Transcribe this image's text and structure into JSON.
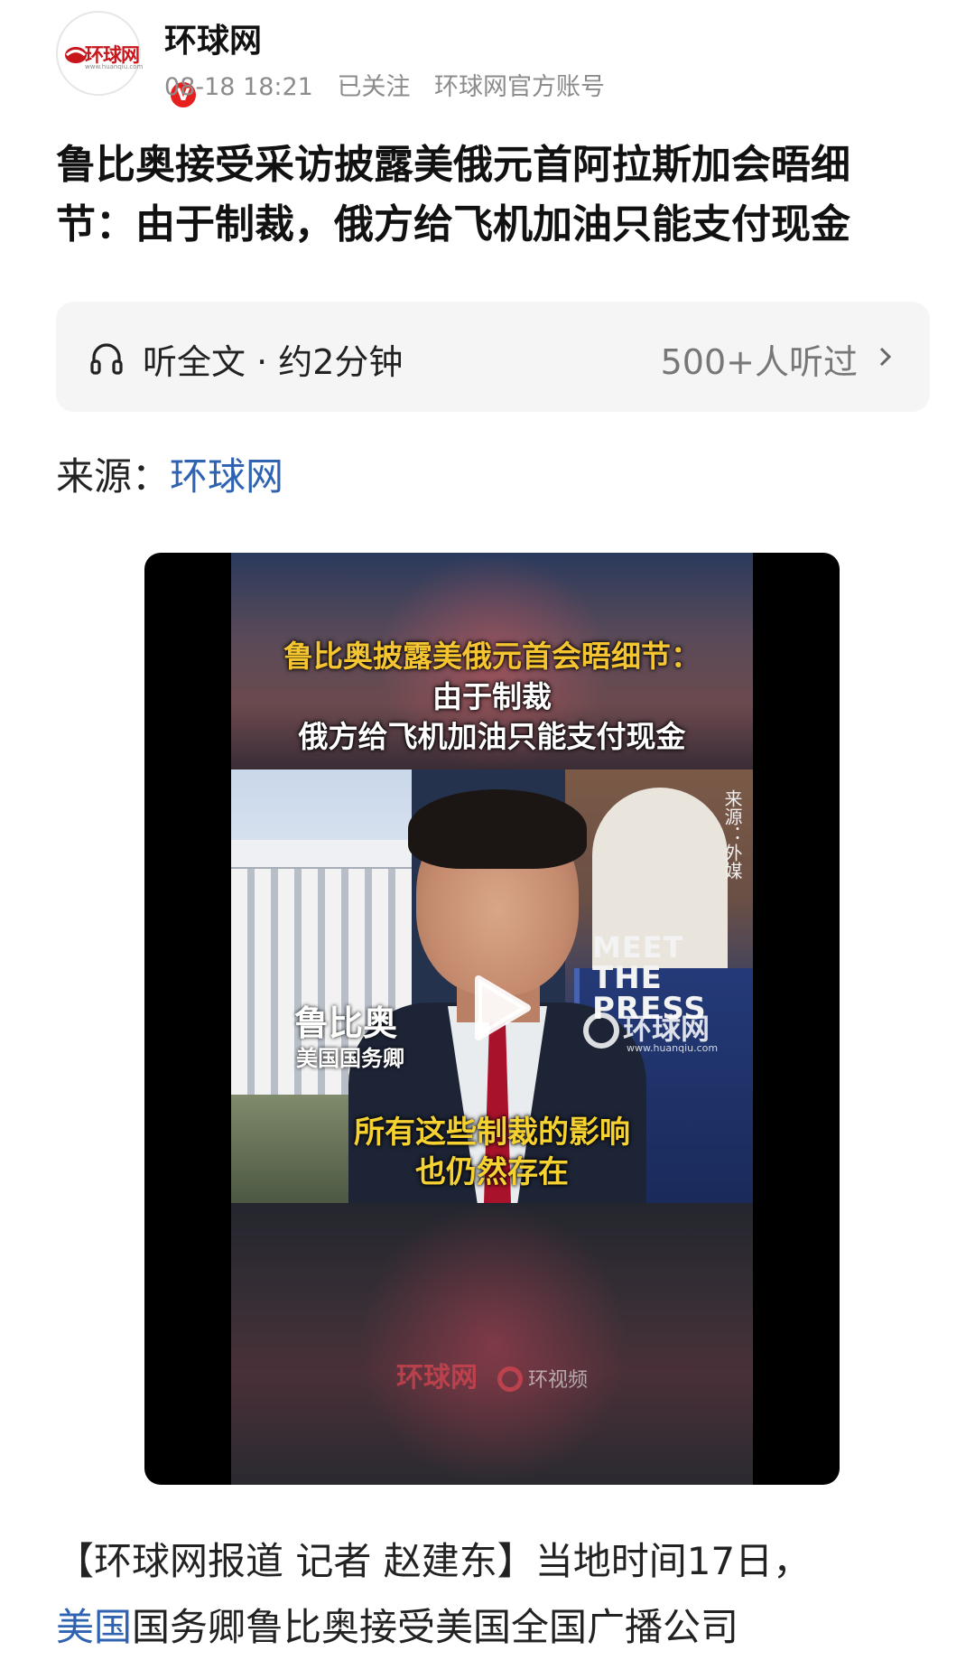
{
  "header": {
    "account_name": "环球网",
    "avatar_logo_text": "环球网",
    "avatar_logo_sub": "www.huanqiu.com",
    "verified_badge": "V",
    "date_time": "08-18 18:21",
    "follow_status": "已关注",
    "account_type": "环球网官方账号"
  },
  "article": {
    "title": "鲁比奥接受采访披露美俄元首阿拉斯加会晤细节：由于制裁，俄方给飞机加油只能支付现金",
    "source_label": "来源：",
    "source_name": "环球网",
    "body_part1": "【环球网报道 记者 赵建东】当地时间17日，",
    "body_link": "美国",
    "body_part2": "国务卿鲁比奥接受美国全国广播公司"
  },
  "listen": {
    "label": "听全文 · 约2分钟",
    "count": "500+人听过"
  },
  "video": {
    "headline_line1": "鲁比奥披露美俄元首会晤细节：",
    "headline_line2": "由于制裁",
    "headline_line3": "俄方给飞机加油只能支付现金",
    "source_tag": "来源：外媒",
    "show_logo_line1": "MEET",
    "show_logo_line2": "THE PRESS",
    "watermark": "环球网",
    "watermark_sub": "www.huanqiu.com",
    "speaker_name": "鲁比奥",
    "speaker_role": "美国国务卿",
    "subtitle_line1": "所有这些制裁的影响",
    "subtitle_line2": "也仍然存在",
    "bottom_logo1": "环球网",
    "bottom_logo2": "环视频"
  },
  "colors": {
    "link": "#2f63b2",
    "verified": "#e5201e",
    "headline_yellow": "#f5c531",
    "subtitle_yellow": "#f5d232"
  },
  "icons": [
    "headphone-icon",
    "chevron-right-icon",
    "play-icon",
    "verified-icon"
  ]
}
